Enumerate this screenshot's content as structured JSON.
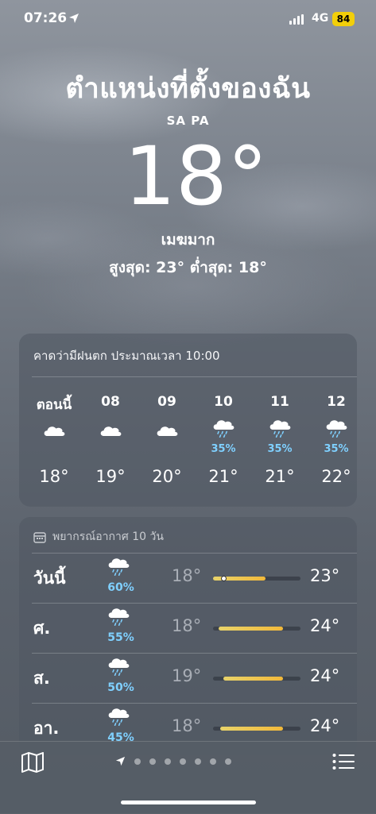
{
  "status": {
    "time": "07:26",
    "network": "4G",
    "battery": "84"
  },
  "header": {
    "location": "ตำแหน่งที่ตั้งของฉัน",
    "city": "SA PA",
    "temperature": "18°",
    "condition": "เมฆมาก",
    "high_low": "สูงสุด: 23°  ต่ำสุด: 18°"
  },
  "hourly": {
    "summary": "คาดว่ามีฝนตก ประมาณเวลา 10:00",
    "items": [
      {
        "label": "ตอนนี้",
        "icon": "cloud-icon",
        "prob": "",
        "temp": "18°"
      },
      {
        "label": "08",
        "icon": "cloud-icon",
        "prob": "",
        "temp": "19°"
      },
      {
        "label": "09",
        "icon": "cloud-icon",
        "prob": "",
        "temp": "20°"
      },
      {
        "label": "10",
        "icon": "rain-cloud-icon",
        "prob": "35%",
        "temp": "21°"
      },
      {
        "label": "11",
        "icon": "rain-cloud-icon",
        "prob": "35%",
        "temp": "21°"
      },
      {
        "label": "12",
        "icon": "rain-cloud-icon",
        "prob": "35%",
        "temp": "22°"
      }
    ]
  },
  "daily": {
    "title": "พยากรณ์อากาศ 10 วัน",
    "days": [
      {
        "name": "วันนี้",
        "icon": "rain-cloud-icon",
        "prob": "60%",
        "low": "18°",
        "high": "23°",
        "range_start": 0.0,
        "range_end": 0.6,
        "current": 0.12
      },
      {
        "name": "ศ.",
        "icon": "rain-cloud-icon",
        "prob": "55%",
        "low": "18°",
        "high": "24°",
        "range_start": 0.06,
        "range_end": 0.8,
        "current": null
      },
      {
        "name": "ส.",
        "icon": "rain-cloud-icon",
        "prob": "50%",
        "low": "19°",
        "high": "24°",
        "range_start": 0.12,
        "range_end": 0.8,
        "current": null
      },
      {
        "name": "อา.",
        "icon": "rain-cloud-icon",
        "prob": "45%",
        "low": "18°",
        "high": "24°",
        "range_start": 0.08,
        "range_end": 0.8,
        "current": null
      }
    ]
  },
  "bottom": {
    "page_count": 7
  },
  "colors": {
    "precip": "#7fd0ff",
    "bar": "#f2b93a",
    "battery": "#f2cf0a"
  }
}
